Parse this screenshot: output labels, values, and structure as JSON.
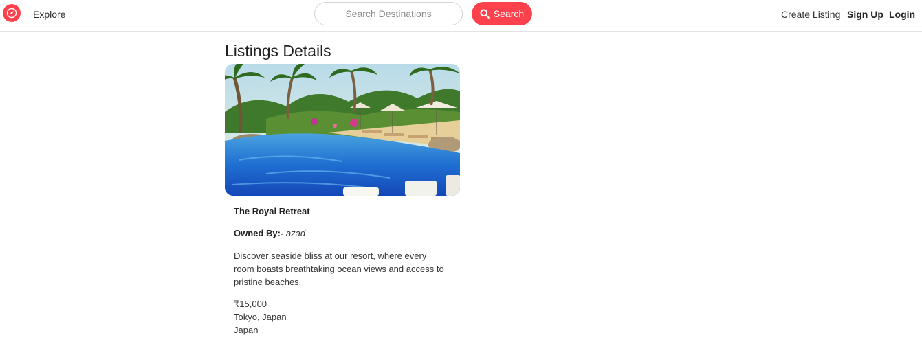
{
  "navbar": {
    "explore_label": "Explore",
    "search_placeholder": "Search Destinations",
    "search_button_label": "Search",
    "create_listing_label": "Create Listing",
    "signup_label": "Sign Up",
    "login_label": "Login",
    "brand_icon": "compass-icon",
    "accent_color": "#fe424d"
  },
  "page": {
    "title": "Listings Details"
  },
  "listing": {
    "title": "The Royal Retreat",
    "owner_label": "Owned By:-",
    "owner_name": "azad",
    "description": "Discover seaside bliss at our resort, where every room boasts breathtaking ocean views and access to pristine beaches.",
    "price": "₹15,000",
    "location": "Tokyo, Japan",
    "country": "Japan"
  }
}
